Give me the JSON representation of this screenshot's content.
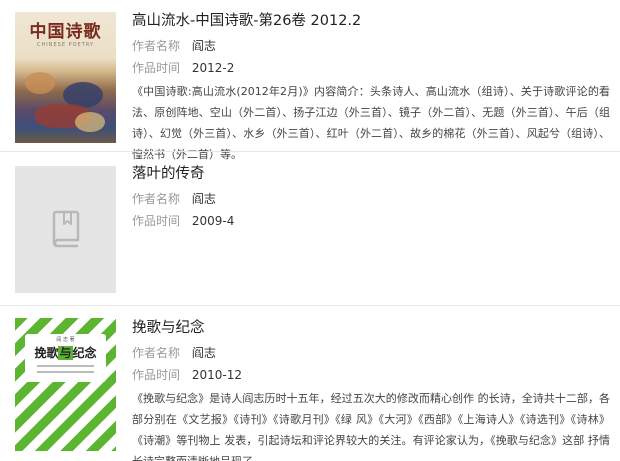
{
  "labels": {
    "author": "作者名称",
    "time": "作品时间"
  },
  "items": [
    {
      "title": "高山流水-中国诗歌-第26卷 2012.2",
      "author": "阎志",
      "time": "2012-2",
      "description": "《中国诗歌:高山流水(2012年2月)》内容简介：头条诗人、高山流水（组诗）、关于诗歌评论的看法、原创阵地、空山（外二首）、扬子江边（外三首）、镜子（外二首）、无题（外三首）、午后（组诗）、幻觉（外三首）、水乡（外三首）、红叶（外二首）、故乡的棉花（外三首）、风起兮（组诗）、惶然书（外二首）等。",
      "cover": {
        "title": "中国诗歌",
        "subtitle": "CHINESE POETRY"
      }
    },
    {
      "title": "落叶的传奇",
      "author": "阎志",
      "time": "2009-4",
      "description": "",
      "cover": {
        "icon": "book-icon"
      }
    },
    {
      "title": "挽歌与纪念",
      "author": "阎志",
      "time": "2010-12",
      "description": "《挽歌与纪念》是诗人阎志历时十五年，经过五次大的修改而精心创作 的长诗，全诗共十二部，各部分别在《文艺报》《诗刊》《诗歌月刊》《绿 风》《大河》《西部》《上海诗人》《诗选刊》《诗林》《诗潮》等刊物上 发表，引起诗坛和评论界较大的关注。有评论家认为，《挽歌与纪念》这部 抒情长诗完整而清晰地呈现了...",
      "cover": {
        "title_part1": "挽歌",
        "title_part2": "与",
        "title_part3": "纪念",
        "author": "阎 志 著"
      }
    }
  ],
  "colors": {
    "placeholder_bg": "#e5e5e5",
    "stripe_green": "#5cb531",
    "label_gray": "#999999",
    "divider": "#e8e8e8"
  }
}
